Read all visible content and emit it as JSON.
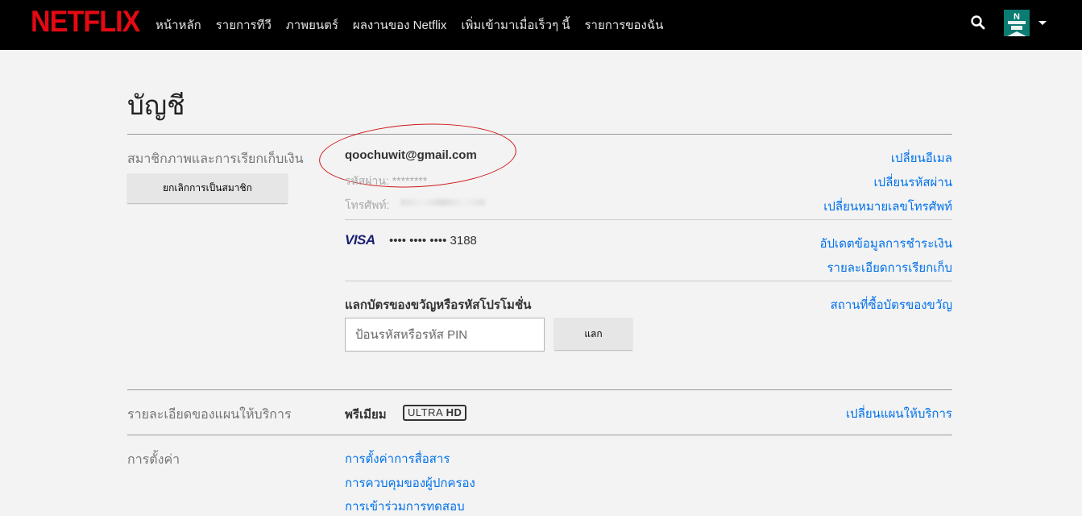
{
  "header": {
    "logo": "NETFLIX",
    "nav": [
      "หน้าหลัก",
      "รายการทีวี",
      "ภาพยนตร์",
      "ผลงานของ Netflix",
      "เพิ่มเข้ามาเมื่อเร็วๆ นี้",
      "รายการของฉัน"
    ],
    "avatar_letter": "N"
  },
  "page": {
    "title": "บัญชี"
  },
  "membership": {
    "label": "สมาชิกภาพและการเรียกเก็บเงิน",
    "cancel_button": "ยกเลิกการเป็นสมาชิก",
    "email": "qoochuwit@gmail.com",
    "password_label": "รหัสผ่าน: ********",
    "phone_label": "โทรศัพท์:",
    "links": {
      "change_email": "เปลี่ยนอีเมล",
      "change_password": "เปลี่ยนรหัสผ่าน",
      "change_phone": "เปลี่ยนหมายเลขโทรศัพท์"
    },
    "card": {
      "brand": "VISA",
      "masked_number": "•••• •••• •••• 3188",
      "update_payment": "อัปเดตข้อมูลการชำระเงิน",
      "billing_details": "รายละเอียดการเรียกเก็บ"
    },
    "gift": {
      "heading": "แลกบัตรของขวัญหรือรหัสโปรโมชั่น",
      "placeholder": "ป้อนรหัสหรือรหัส PIN",
      "redeem_button": "แลก",
      "where_to_buy": "สถานที่ซื้อบัตรของขวัญ"
    }
  },
  "plan": {
    "label": "รายละเอียดของแผนให้บริการ",
    "name": "พรีเมียม",
    "badge_ultra": "ULTRA",
    "badge_hd": "HD",
    "change_plan": "เปลี่ยนแผนให้บริการ"
  },
  "settings": {
    "label": "การตั้งค่า",
    "items": [
      "การตั้งค่าการสื่อสาร",
      "การควบคุมของผู้ปกครอง",
      "การเข้าร่วมการทดสอบ"
    ]
  },
  "colors": {
    "brand": "#e50914",
    "link": "#0071eb",
    "annotation": "#d01818"
  }
}
